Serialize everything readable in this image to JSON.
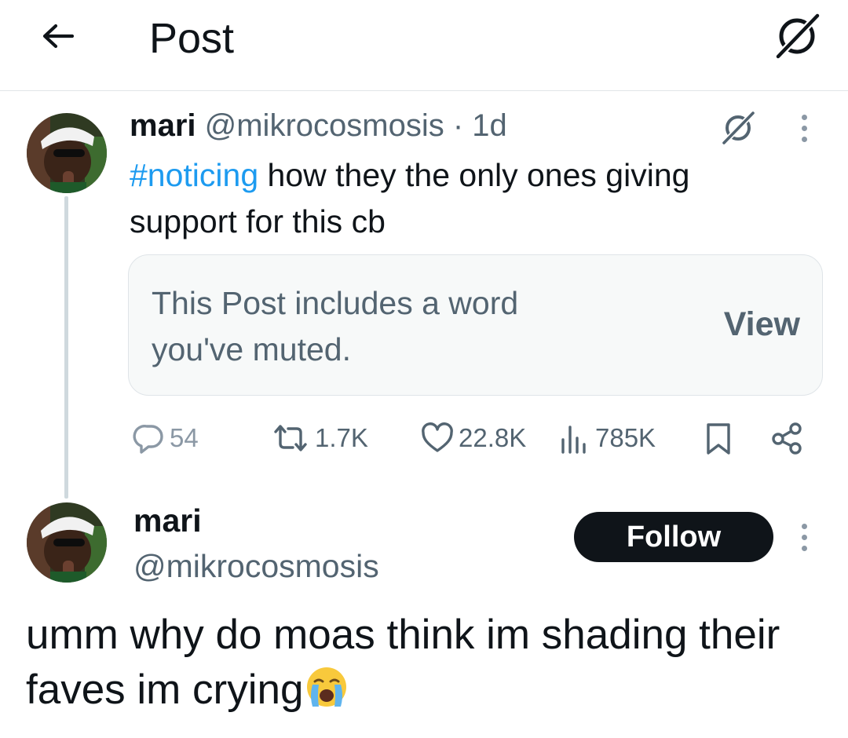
{
  "header": {
    "title": "Post"
  },
  "quoted_post": {
    "author_name": "mari",
    "handle_time": "@mikrocosmosis · 1d",
    "hashtag": "#noticing",
    "text_rest": " how they the only ones giving support for this cb",
    "muted_notice": "This Post includes a word you've muted.",
    "view_label": "View",
    "stats": {
      "replies": "54",
      "reposts": "1.7K",
      "likes": "22.8K",
      "views": "785K"
    }
  },
  "main_post": {
    "author_name": "mari",
    "handle": "@mikrocosmosis",
    "follow_label": "Follow",
    "text": "umm why do moas think im shading their faves im crying"
  },
  "colors": {
    "link": "#1d9bf0",
    "secondary_text": "#536471",
    "follow_bg": "#0f1419"
  }
}
